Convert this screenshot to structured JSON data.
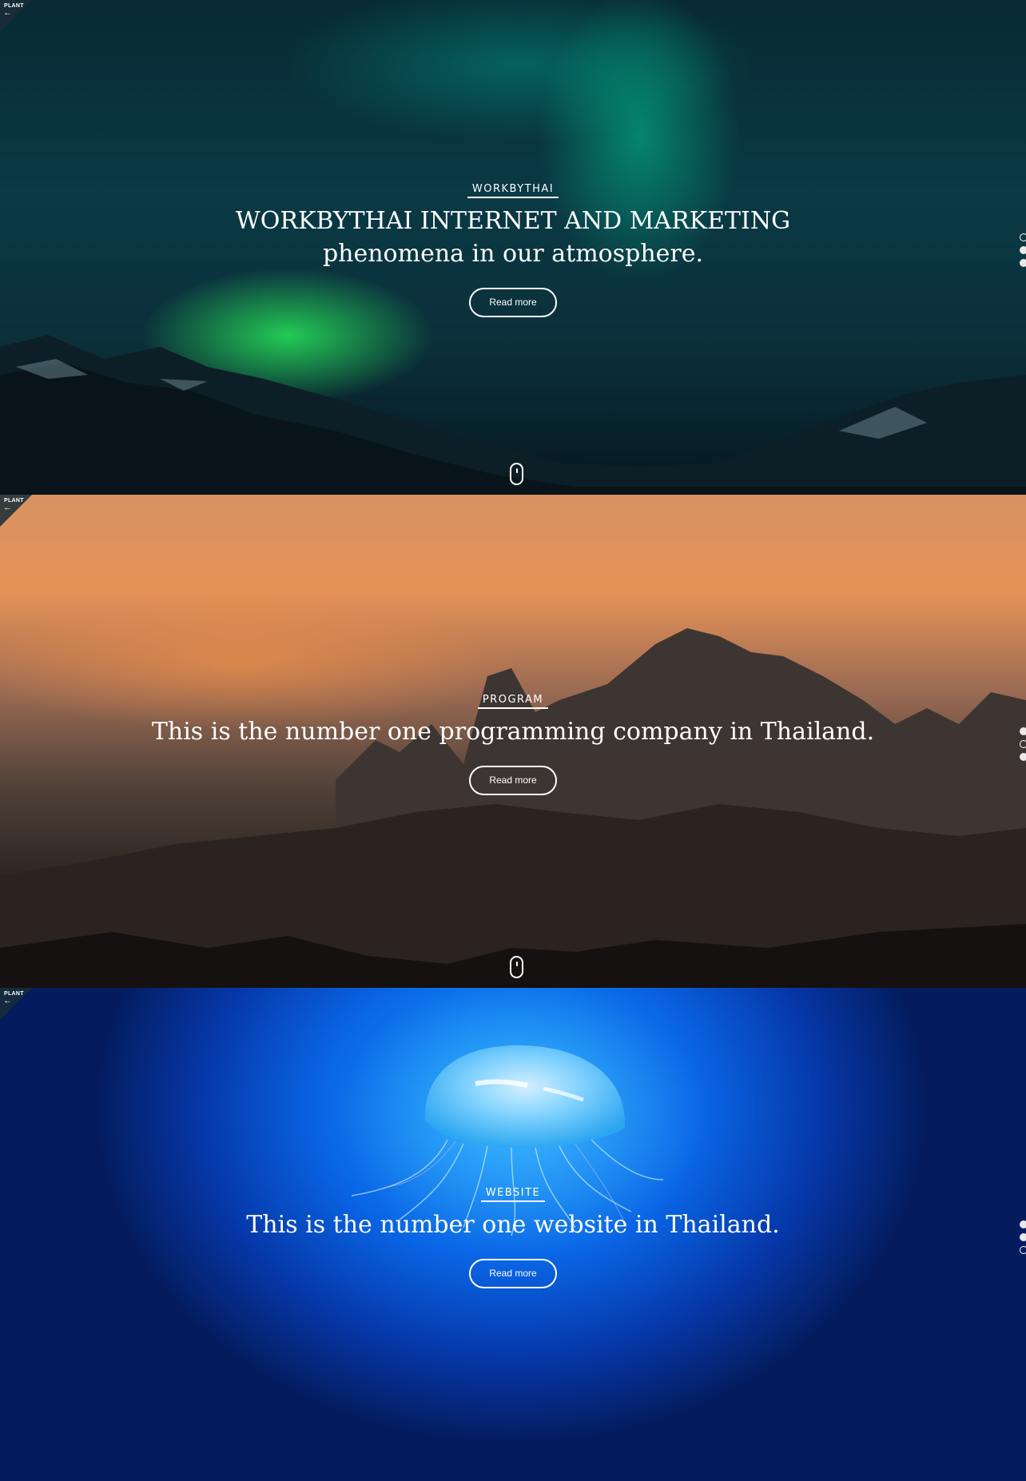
{
  "brand": "PLANT",
  "back_arrow_icon": "left-arrow-icon",
  "slides": [
    {
      "kicker": "WORKBYTHAI",
      "title_line1": "WORKBYTHAI INTERNET AND MARKETING",
      "title_line2": "phenomena in our atmosphere.",
      "button": "Read more",
      "active_dot": 1
    },
    {
      "kicker": "PROGRAM",
      "title_line1": "This is the number one programming company in Thailand.",
      "button": "Read more",
      "active_dot": 2
    },
    {
      "kicker": "WEBSITE",
      "title_line1": "This is the number one website in Thailand.",
      "button": "Read more",
      "active_dot": 3
    }
  ],
  "colors": {
    "aurora": "#2fe36a",
    "sunset": "#e59157",
    "ocean": "#0a66e6"
  }
}
